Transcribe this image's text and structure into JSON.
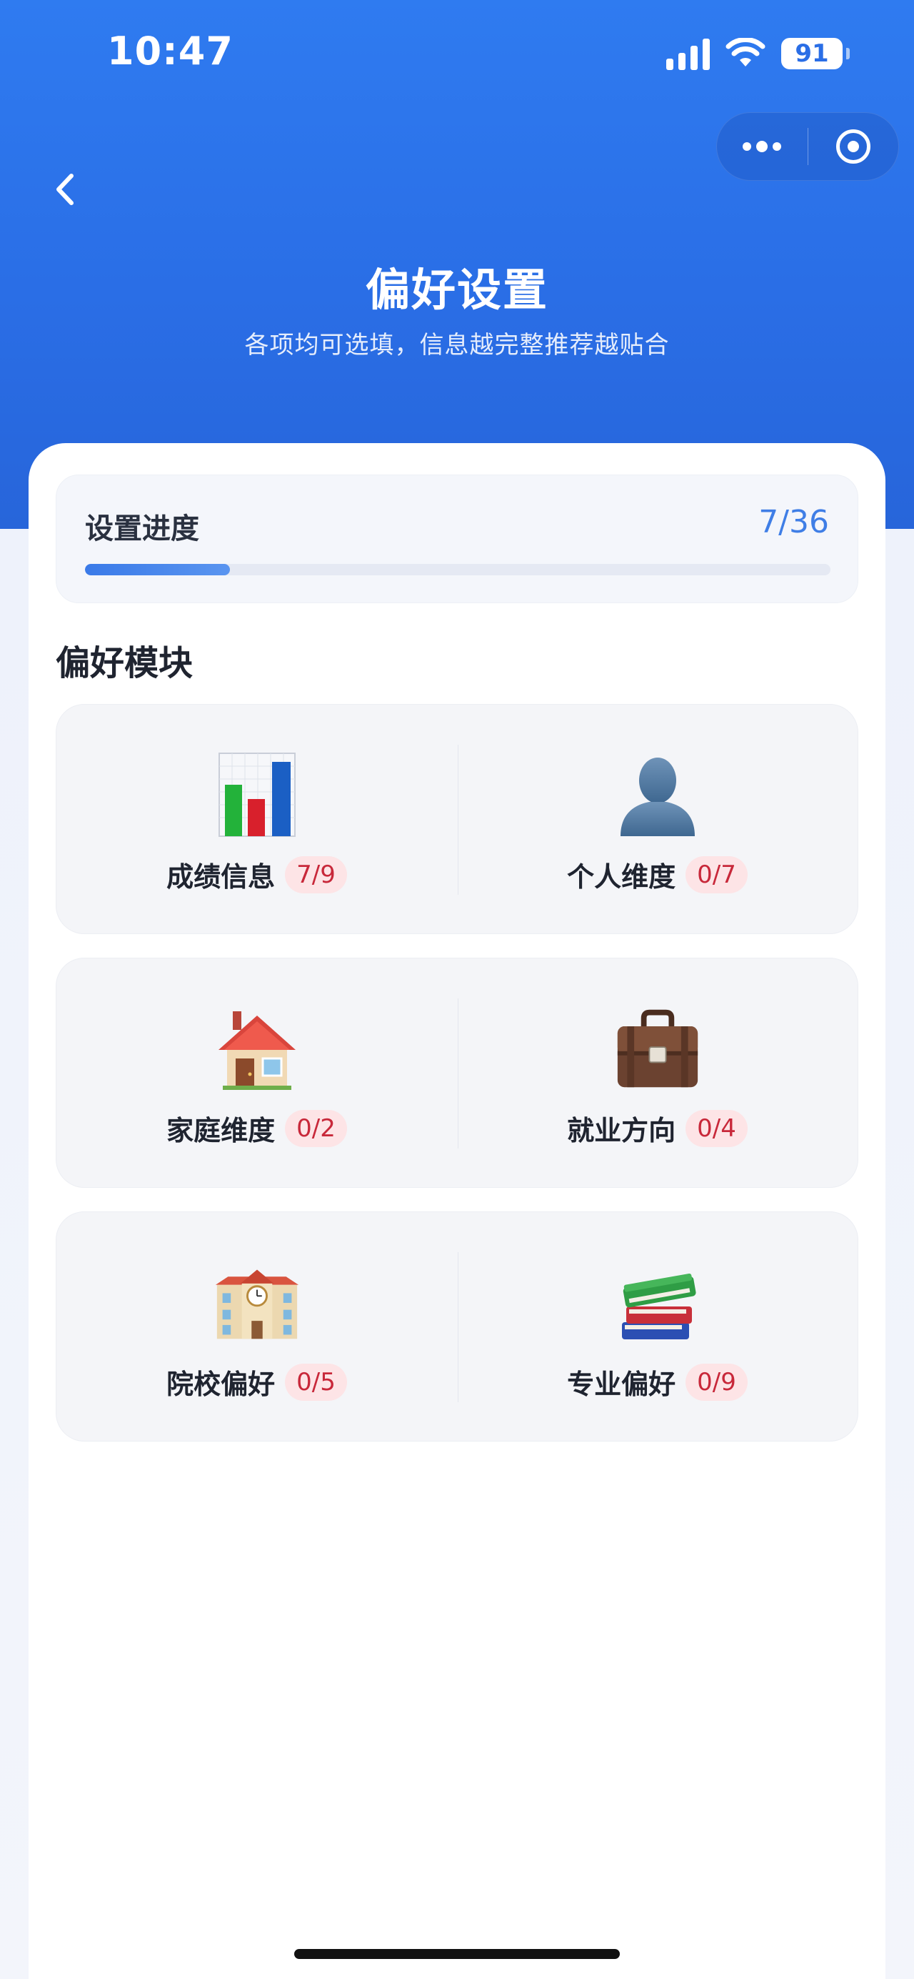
{
  "status_bar": {
    "time": "10:47",
    "battery": "91"
  },
  "header": {
    "title": "偏好设置",
    "subtitle": "各项均可选填，信息越完整推荐越贴合"
  },
  "progress": {
    "label": "设置进度",
    "count": "7/36",
    "completed": 7,
    "total": 36
  },
  "section": {
    "title": "偏好模块"
  },
  "modules": [
    {
      "name": "成绩信息",
      "badge": "7/9",
      "icon": "bar-chart-icon"
    },
    {
      "name": "个人维度",
      "badge": "0/7",
      "icon": "person-silhouette-icon"
    },
    {
      "name": "家庭维度",
      "badge": "0/2",
      "icon": "house-icon"
    },
    {
      "name": "就业方向",
      "badge": "0/4",
      "icon": "briefcase-icon"
    },
    {
      "name": "院校偏好",
      "badge": "0/5",
      "icon": "school-building-icon"
    },
    {
      "name": "专业偏好",
      "badge": "0/9",
      "icon": "books-icon"
    }
  ],
  "colors": {
    "header_blue": "#2a6ee6",
    "accent": "#3f7ee6",
    "badge_bg": "#fde4e6",
    "badge_text": "#c8283a"
  }
}
